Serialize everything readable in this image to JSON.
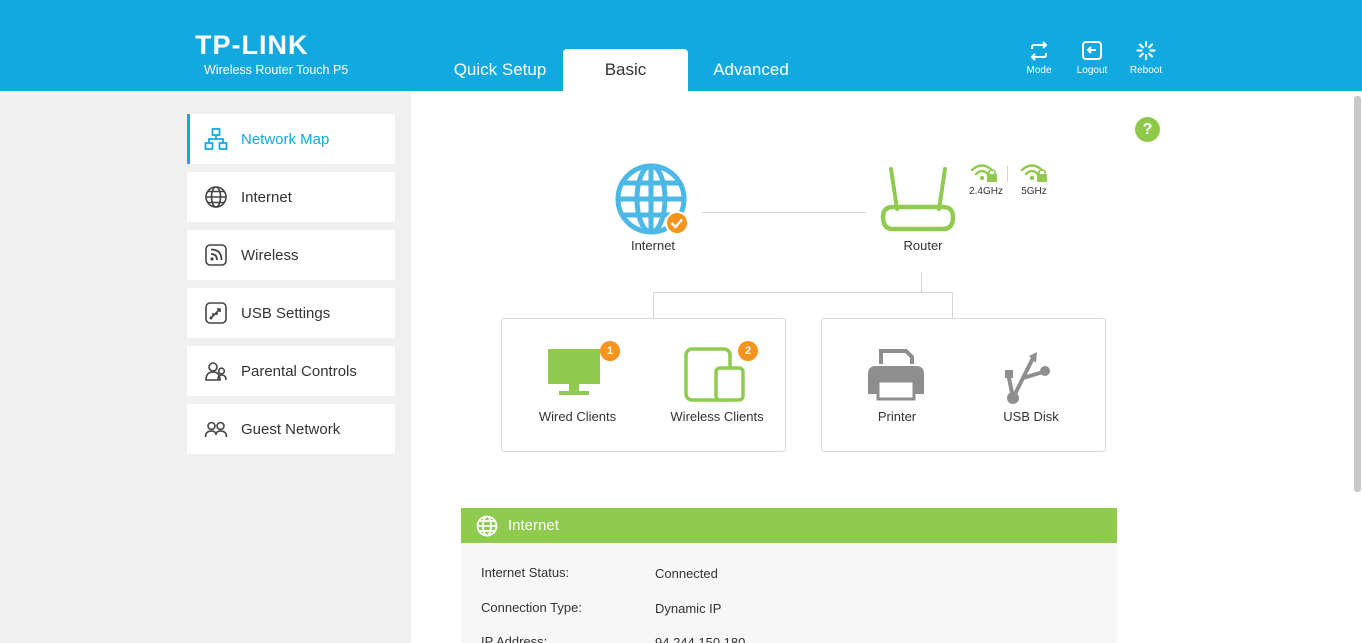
{
  "header": {
    "brand": "TP-LINK",
    "model": "Wireless Router Touch P5",
    "tabs": [
      {
        "label": "Quick Setup"
      },
      {
        "label": "Basic"
      },
      {
        "label": "Advanced"
      }
    ],
    "actions": [
      {
        "label": "Mode",
        "icon": "mode-icon"
      },
      {
        "label": "Logout",
        "icon": "logout-icon"
      },
      {
        "label": "Reboot",
        "icon": "reboot-icon"
      }
    ]
  },
  "sidebar": {
    "items": [
      {
        "label": "Network Map",
        "icon": "network-map-icon",
        "active": true
      },
      {
        "label": "Internet",
        "icon": "globe-icon"
      },
      {
        "label": "Wireless",
        "icon": "wireless-icon"
      },
      {
        "label": "USB Settings",
        "icon": "usb-settings-icon"
      },
      {
        "label": "Parental Controls",
        "icon": "parental-controls-icon"
      },
      {
        "label": "Guest Network",
        "icon": "guest-network-icon"
      }
    ]
  },
  "map": {
    "help": "?",
    "internet_label": "Internet",
    "router_label": "Router",
    "band_24": "2.4GHz",
    "band_5": "5GHz",
    "wired_label": "Wired Clients",
    "wired_count": "1",
    "wireless_label": "Wireless Clients",
    "wireless_count": "2",
    "printer_label": "Printer",
    "usb_label": "USB Disk"
  },
  "internet_panel": {
    "title": "Internet",
    "rows": [
      {
        "label": "Internet Status:",
        "value": "Connected"
      },
      {
        "label": "Connection Type:",
        "value": "Dynamic IP"
      },
      {
        "label": "IP Address:",
        "value": "94.244.150.180"
      }
    ]
  },
  "colors": {
    "header_blue": "#12a9e0",
    "accent_green": "#8fcb4f",
    "badge_orange": "#f7941d",
    "globe_blue": "#4cb8e6"
  }
}
